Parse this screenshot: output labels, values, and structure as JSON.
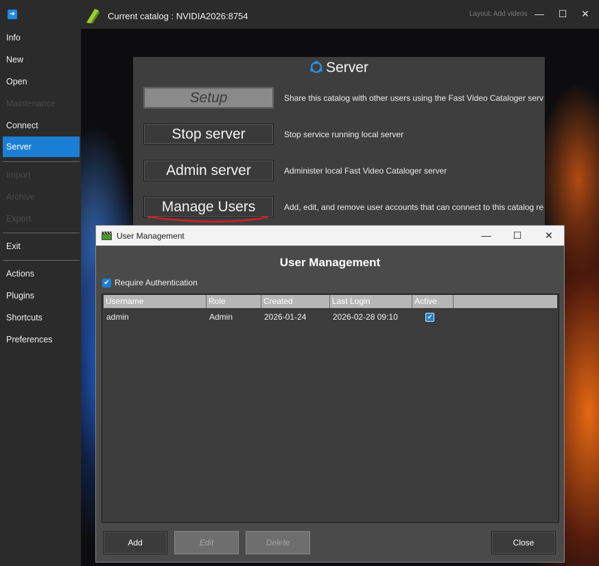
{
  "titlebar": {
    "title": "Current catalog : NVIDIA2026:8754",
    "layout": "Layout: Add videos",
    "minimize": "—",
    "maximize": "☐",
    "close": "✕"
  },
  "sidebar": {
    "items": [
      {
        "label": "Info"
      },
      {
        "label": "New"
      },
      {
        "label": "Open"
      },
      {
        "label": "Maintenance"
      },
      {
        "label": "Connect"
      },
      {
        "label": "Server"
      },
      {
        "label": "Import"
      },
      {
        "label": "Archive"
      },
      {
        "label": "Export"
      },
      {
        "label": "Exit"
      },
      {
        "label": "Actions"
      },
      {
        "label": "Plugins"
      },
      {
        "label": "Shortcuts"
      },
      {
        "label": "Preferences"
      }
    ]
  },
  "server": {
    "title": "Server",
    "buttons": [
      {
        "label": "Setup",
        "desc": "Share this catalog with other users using the Fast Video Cataloger server"
      },
      {
        "label": "Stop server",
        "desc": "Stop service running local server"
      },
      {
        "label": "Admin server",
        "desc": "Administer local Fast Video Cataloger server"
      },
      {
        "label": "Manage Users",
        "desc": "Add, edit, and remove user accounts that can connect to this catalog remotely"
      }
    ]
  },
  "dialog": {
    "title": "User Management",
    "heading": "User Management",
    "require_auth_label": "Require Authentication",
    "require_auth_checked": true,
    "columns": [
      "Username",
      "Role",
      "Created",
      "Last Login",
      "Active"
    ],
    "rows": [
      {
        "username": "admin",
        "role": "Admin",
        "created": "2026-01-24",
        "last_login": "2026-02-28 09:10",
        "active": true
      }
    ],
    "buttons": {
      "add": "Add",
      "edit": "Edit",
      "delete": "Delete",
      "close": "Close"
    },
    "win": {
      "minimize": "—",
      "maximize": "☐",
      "close": "✕"
    }
  },
  "colors": {
    "accent": "#1a7fd4",
    "annotation": "#d42020"
  }
}
